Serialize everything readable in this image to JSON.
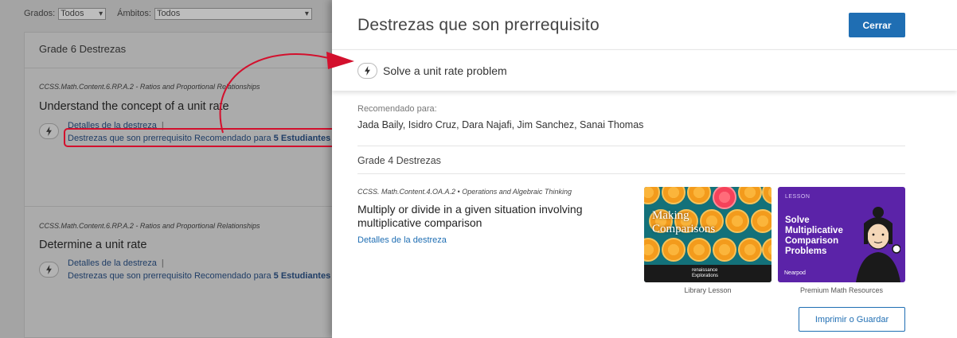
{
  "filters": {
    "grades_label": "Grados:",
    "grades_value": "Todos",
    "scopes_label": "Ámbitos:",
    "scopes_value": "Todos"
  },
  "background": {
    "card_title": "Grade 6 Destrezas",
    "skills": [
      {
        "meta": "CCSS.Math.Content.6.RP.A.2 - Ratios and Proportional Relationships",
        "title": "Understand the concept of a unit rate",
        "details_link": "Detalles de la destreza",
        "prereq_link": "Destrezas que son prerrequisito",
        "recommended_prefix": "Recomendado para",
        "recommended_count": "5 Estudiantes"
      },
      {
        "meta": "CCSS.Math.Content.6.RP.A.2 - Ratios and Proportional Relationships",
        "title": "Determine a unit rate",
        "details_link": "Detalles de la destreza",
        "prereq_link": "Destrezas que son prerrequisito",
        "recommended_prefix": "Recomendado para",
        "recommended_count": "5 Estudiantes"
      }
    ]
  },
  "drawer": {
    "title": "Destrezas que son prerrequisito",
    "close_label": "Cerrar",
    "selected_skill": "Solve a unit rate problem",
    "recommended_label": "Recomendado para:",
    "recommended_names": "Jada Baily, Isidro Cruz, Dara Najafi, Jim Sanchez, Sanai Thomas",
    "grade_label": "Grade 4 Destrezas",
    "skill_meta": "CCSS. Math.Content.4.OA.A.2 • Operations and Algebraic Thinking",
    "skill_title": "Multiply or divide in a given situation involving multiplicative comparison",
    "skill_details_link": "Detalles de la destreza",
    "resources": [
      {
        "caption": "Library Lesson",
        "thumb_title": "Making Comparisons",
        "thumb_brand_top": "renaissance",
        "thumb_brand": "Explorations"
      },
      {
        "caption": "Premium Math Resources",
        "thumb_kicker": "LESSON",
        "thumb_title": "Solve Multiplicative Comparison Problems",
        "thumb_logo": "Nearpod"
      }
    ],
    "print_label": "Imprimir o Guardar"
  },
  "colors": {
    "primary": "#1f6eb3",
    "highlight": "#d3102d"
  },
  "icons": {
    "skill": "lightning-bolt-icon",
    "dropdown": "chevron-down-icon"
  }
}
